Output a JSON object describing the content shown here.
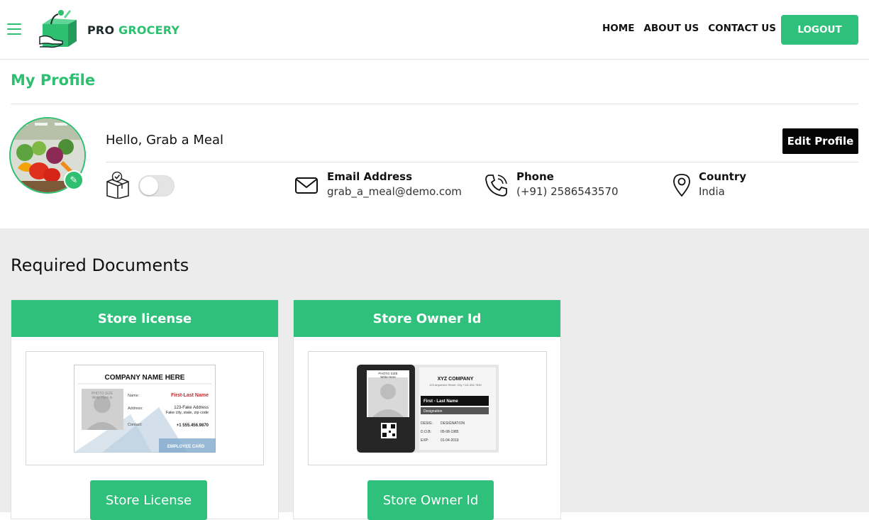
{
  "header": {
    "logo_pro": "PRO",
    "logo_grocery": "GROCERY",
    "nav": [
      "HOME",
      "ABOUT US",
      "CONTACT US"
    ],
    "logout_label": "LOGOUT"
  },
  "profile": {
    "page_title": "My Profile",
    "greeting": "Hello, Grab a Meal",
    "edit_label": "Edit Profile",
    "email": {
      "label": "Email Address",
      "value": "grab_a_meal@demo.com"
    },
    "phone": {
      "label": "Phone",
      "value": "(+91) 2586543570"
    },
    "country": {
      "label": "Country",
      "value": "India"
    },
    "toggle_on": false
  },
  "documents": {
    "title": "Required Documents",
    "cards": [
      {
        "header": "Store license",
        "button": "Store License",
        "card": {
          "company": "COMPANY NAME HERE",
          "photo_line1": "PHOTO SIZE",
          "photo_line2": "Write Here in",
          "name_label": "Name:",
          "name_value": "First-Last Name",
          "address_label": "Address:",
          "address_line1": "123-Fake Address",
          "address_line2": "Fake city, state, zip code",
          "contact_label": "Contact:",
          "contact_value": "+1 555.456.9870",
          "footer": "EMPLOYEE CARD"
        }
      },
      {
        "header": "Store Owner Id",
        "button": "Store Owner Id",
        "card": {
          "photo_line1": "PHOTO SIZE",
          "photo_line2": "Write Here",
          "company": "XYZ COMPANY",
          "address": "123 Anywhere Street, City +111 654 7890",
          "name": "First - Last Name",
          "designation": "Designation",
          "desig_label": "DESIG:",
          "desig_value": "DESIGNATION",
          "dob_label": "D.O.B:",
          "dob_value": "05-08-1985",
          "exp_label": "EXP:",
          "exp_value": "01-04-2019"
        }
      }
    ]
  },
  "colors": {
    "brand_green": "#2fc07c",
    "logo_dark": "#1d2b2a",
    "docs_bg": "#ececec"
  }
}
